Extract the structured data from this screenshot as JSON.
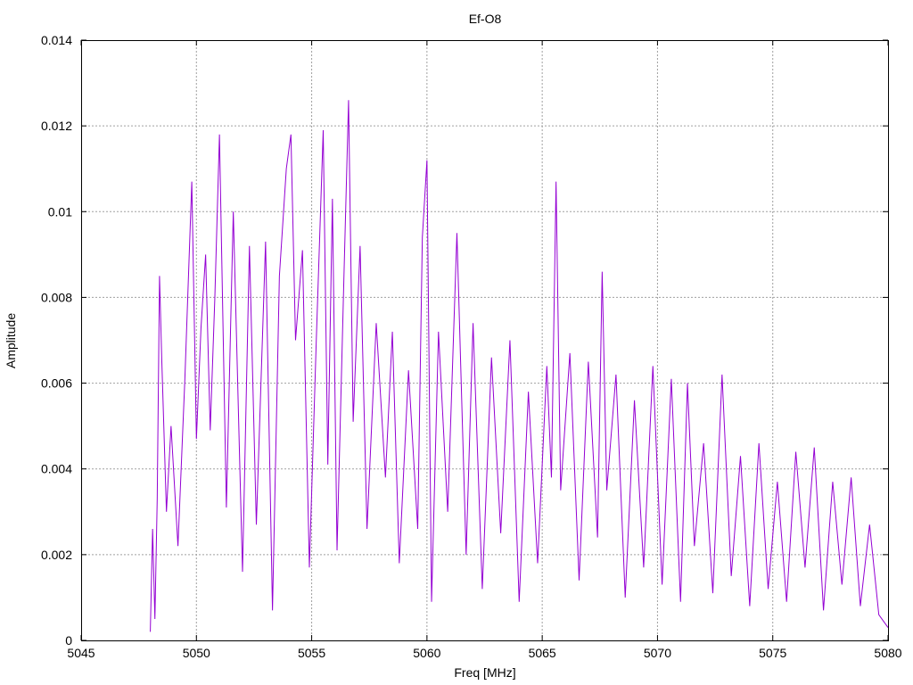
{
  "chart_data": {
    "type": "line",
    "title": "Ef-O8",
    "xlabel": "Freq [MHz]",
    "ylabel": "Amplitude",
    "xlim": [
      5045,
      5080
    ],
    "ylim": [
      0,
      0.014
    ],
    "x_ticks": [
      "5045",
      "5050",
      "5055",
      "5060",
      "5065",
      "5070",
      "5075",
      "5080"
    ],
    "y_ticks": [
      "0",
      "0.002",
      "0.004",
      "0.006",
      "0.008",
      "0.01",
      "0.012",
      "0.014"
    ],
    "grid": true,
    "series": [
      {
        "color": "#9400d3",
        "x_start": 5048.0,
        "x_end": 5080.0,
        "x": [
          5048.0,
          5048.1,
          5048.2,
          5048.3,
          5048.4,
          5048.5,
          5048.7,
          5048.9,
          5049.2,
          5049.5,
          5049.8,
          5050.0,
          5050.2,
          5050.4,
          5050.6,
          5050.8,
          5051.0,
          5051.3,
          5051.6,
          5052.0,
          5052.3,
          5052.6,
          5053.0,
          5053.3,
          5053.6,
          5053.9,
          5054.1,
          5054.3,
          5054.6,
          5054.9,
          5055.2,
          5055.5,
          5055.7,
          5055.9,
          5056.1,
          5056.4,
          5056.6,
          5056.8,
          5057.1,
          5057.4,
          5057.8,
          5058.2,
          5058.5,
          5058.8,
          5059.2,
          5059.6,
          5059.8,
          5060.0,
          5060.2,
          5060.5,
          5060.9,
          5061.3,
          5061.7,
          5062.0,
          5062.4,
          5062.8,
          5063.2,
          5063.6,
          5064.0,
          5064.4,
          5064.8,
          5065.2,
          5065.4,
          5065.6,
          5065.8,
          5066.2,
          5066.6,
          5067.0,
          5067.4,
          5067.6,
          5067.8,
          5068.2,
          5068.6,
          5069.0,
          5069.4,
          5069.8,
          5070.2,
          5070.6,
          5071.0,
          5071.3,
          5071.6,
          5072.0,
          5072.4,
          5072.8,
          5073.2,
          5073.6,
          5074.0,
          5074.4,
          5074.8,
          5075.2,
          5075.6,
          5076.0,
          5076.4,
          5076.8,
          5077.2,
          5077.6,
          5078.0,
          5078.4,
          5078.8,
          5079.2,
          5079.6,
          5080.0
        ],
        "y": [
          0.0002,
          0.0026,
          0.0005,
          0.0033,
          0.0085,
          0.0065,
          0.003,
          0.005,
          0.0022,
          0.0061,
          0.0107,
          0.0047,
          0.0073,
          0.009,
          0.0049,
          0.008,
          0.0118,
          0.0031,
          0.01,
          0.0016,
          0.0092,
          0.0027,
          0.0093,
          0.0007,
          0.0085,
          0.011,
          0.0118,
          0.007,
          0.0091,
          0.0017,
          0.007,
          0.0119,
          0.0041,
          0.0103,
          0.0021,
          0.0085,
          0.0126,
          0.0051,
          0.0092,
          0.0026,
          0.0074,
          0.0038,
          0.0072,
          0.0018,
          0.0063,
          0.0026,
          0.0094,
          0.0112,
          0.0009,
          0.0072,
          0.003,
          0.0095,
          0.002,
          0.0074,
          0.0012,
          0.0066,
          0.0025,
          0.007,
          0.0009,
          0.0058,
          0.0018,
          0.0064,
          0.0038,
          0.0107,
          0.0035,
          0.0067,
          0.0014,
          0.0065,
          0.0024,
          0.0086,
          0.0035,
          0.0062,
          0.001,
          0.0056,
          0.0017,
          0.0064,
          0.0013,
          0.0061,
          0.0009,
          0.006,
          0.0022,
          0.0046,
          0.0011,
          0.0062,
          0.0015,
          0.0043,
          0.0008,
          0.0046,
          0.0012,
          0.0037,
          0.0009,
          0.0044,
          0.0017,
          0.0045,
          0.0007,
          0.0037,
          0.0013,
          0.0038,
          0.0008,
          0.0027,
          0.0006,
          0.0003
        ]
      }
    ]
  }
}
